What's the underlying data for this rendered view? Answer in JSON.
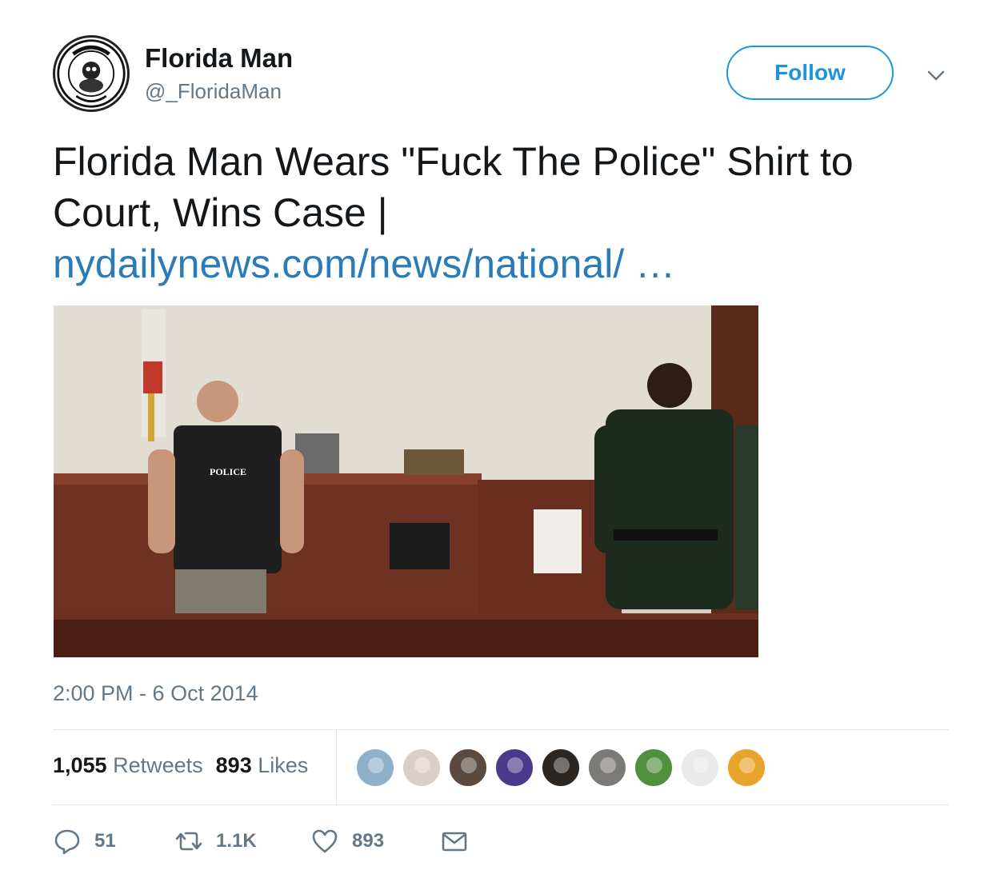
{
  "user": {
    "display_name": "Florida Man",
    "handle": "@_FloridaMan",
    "avatar_icon": "florida-man-seal-logo",
    "avatar_text": "FLORIDA MAN · FLORIDA DEPT. OF CRAZY"
  },
  "follow_label": "Follow",
  "tweet": {
    "text": "Florida Man Wears \"Fuck The Police\" Shirt to Court, Wins Case |",
    "link_text": "nydailynews.com/news/national/  …",
    "media_alt_shirt_text": "POLICE",
    "timestamp": "2:00 PM - 6 Oct 2014"
  },
  "stats": {
    "retweets_count": "1,055",
    "retweets_label": "Retweets",
    "likes_count": "893",
    "likes_label": "Likes"
  },
  "likers": [
    {
      "name": "liker-avatar-1",
      "color": "#8fb0c9"
    },
    {
      "name": "liker-avatar-2",
      "color": "#d9cfc8"
    },
    {
      "name": "liker-avatar-3",
      "color": "#5a4a3f"
    },
    {
      "name": "liker-avatar-4",
      "color": "#4b3a8c"
    },
    {
      "name": "liker-avatar-5",
      "color": "#2c2622"
    },
    {
      "name": "liker-avatar-6",
      "color": "#7c7a76"
    },
    {
      "name": "liker-avatar-7",
      "color": "#4f8f3e"
    },
    {
      "name": "liker-avatar-8",
      "color": "#e9e9e9"
    },
    {
      "name": "liker-avatar-9",
      "color": "#e8a42a"
    }
  ],
  "actions": {
    "reply_icon": "reply-icon",
    "reply_count": "51",
    "retweet_icon": "retweet-icon",
    "retweet_count": "1.1K",
    "like_icon": "heart-icon",
    "like_count": "893",
    "dm_icon": "envelope-icon"
  },
  "colors": {
    "accent": "#1b95e0",
    "link": "#2b7bb9",
    "muted": "#657786"
  }
}
